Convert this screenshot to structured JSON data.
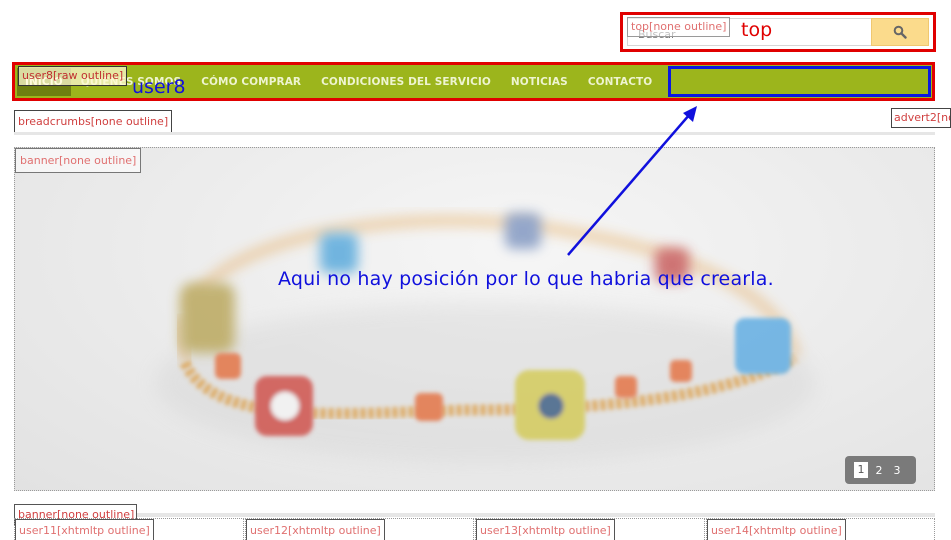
{
  "top": {
    "position_label": "top[none outline]",
    "search_placeholder": "Buscar",
    "annotation": "top",
    "search_icon": "search-icon"
  },
  "menu": {
    "position_label": "user8[raw outline]",
    "annotation": "user8",
    "items": [
      "INICIO",
      "QUIÉNES SOMOS",
      "CÓMO COMPRAR",
      "CONDICIONES DEL SERVICIO",
      "NOTICIAS",
      "CONTACTO"
    ],
    "bar_color": "#9cb51c",
    "highlight_color": "#0a18e0"
  },
  "breadcrumbs": {
    "position_label": "breadcrumbs[none outline]"
  },
  "advert": {
    "position_label": "advert2[none outline]"
  },
  "banner": {
    "position_label": "banner[none outline]",
    "pager": [
      "1",
      "2",
      "3"
    ],
    "active_page": "1"
  },
  "annotation": {
    "text": "Aqui no hay posición por lo que habria que crearla.",
    "color": "#1010dd"
  },
  "banner2": {
    "position_label": "banner[none outline]"
  },
  "user_columns": [
    {
      "label": "user11[xhtmltp outline]",
      "title": "user11"
    },
    {
      "label": "user12[xhtmltp outline]",
      "title": "user12"
    },
    {
      "label": "user13[xhtmltp outline]",
      "title": "user13"
    },
    {
      "label": "user14[xhtmltp outline]",
      "title": "user14"
    }
  ]
}
